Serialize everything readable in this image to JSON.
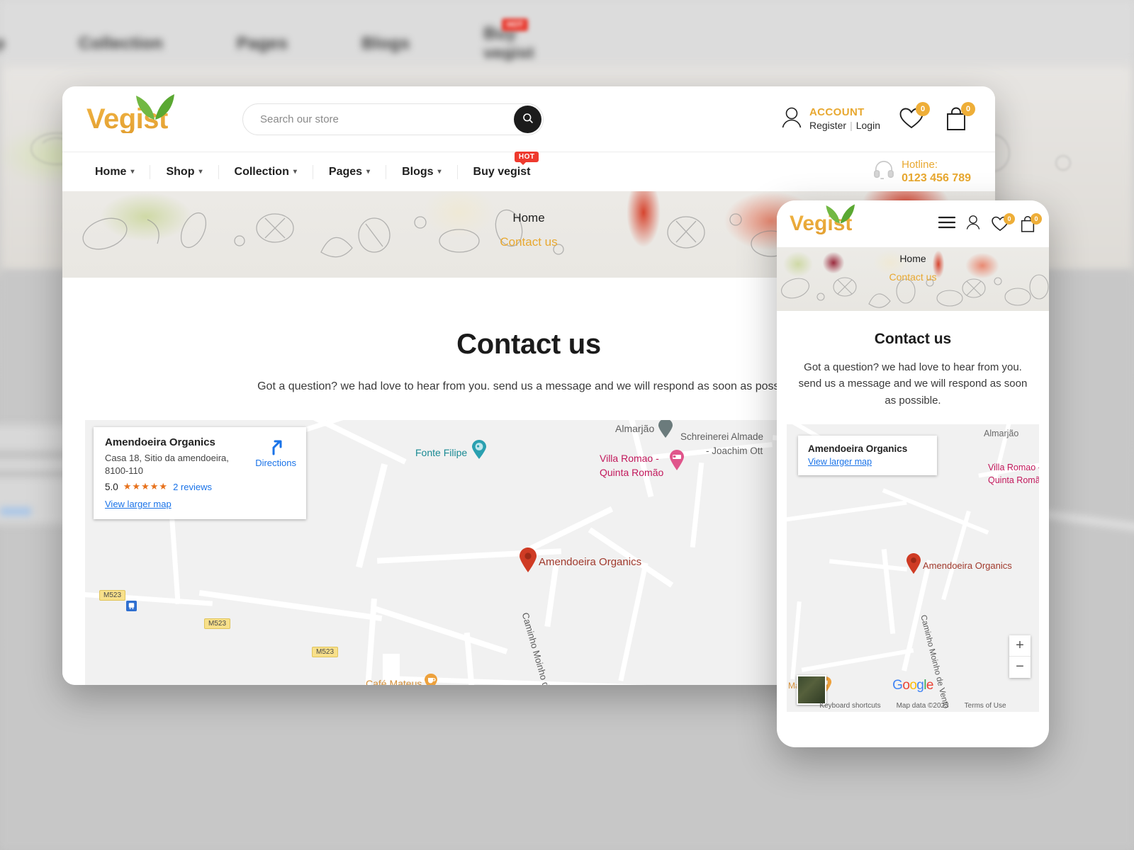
{
  "site": {
    "brand": "Vegist",
    "accent_color": "#e8a830",
    "badge_color": "#eeae38",
    "hot_color": "#ee3a2e"
  },
  "desktop": {
    "search": {
      "placeholder": "Search our store",
      "value": "",
      "icon": "search-icon"
    },
    "account": {
      "title": "ACCOUNT",
      "register": "Register",
      "separator": "|",
      "login": "Login"
    },
    "wishlist_count": "0",
    "cart_count": "0",
    "nav": [
      {
        "label": "Home",
        "has_caret": true,
        "badge": ""
      },
      {
        "label": "Shop",
        "has_caret": true,
        "badge": ""
      },
      {
        "label": "Collection",
        "has_caret": true,
        "badge": ""
      },
      {
        "label": "Pages",
        "has_caret": true,
        "badge": ""
      },
      {
        "label": "Blogs",
        "has_caret": true,
        "badge": ""
      },
      {
        "label": "Buy vegist",
        "has_caret": false,
        "badge": "HOT"
      }
    ],
    "hotline": {
      "label": "Hotline:",
      "number": "0123 456 789"
    },
    "breadcrumb": {
      "home": "Home",
      "current": "Contact us"
    },
    "page": {
      "title": "Contact us",
      "subtitle": "Got a question? we had love to hear from you. send us a message and we will respond as soon as possible."
    }
  },
  "mobile": {
    "wishlist_count": "0",
    "cart_count": "0",
    "breadcrumb": {
      "home": "Home",
      "current": "Contact us"
    },
    "page": {
      "title": "Contact us",
      "subtitle": "Got a question? we had love to hear from you. send us a message and we will respond as soon as possible."
    },
    "map": {
      "info_card": {
        "title": "Amendoeira Organics",
        "view_larger": "View larger map"
      },
      "labels": [
        {
          "text": "Almarjão",
          "color": "#6b6b6b"
        },
        {
          "text": "Villa Romao -",
          "color": "#c2185b"
        },
        {
          "text": "Quinta Romã",
          "color": "#c2185b"
        },
        {
          "text": "Amendoeira Organics",
          "color": "#a0392c"
        },
        {
          "text": "Mateus",
          "color": "#d4903a"
        },
        {
          "text": "Caminho Moinho de Vento",
          "color": "#5a5a5a"
        }
      ],
      "zoom_in": "+",
      "zoom_out": "−",
      "attribution": {
        "keyboard": "Keyboard shortcuts",
        "mapdata": "Map data ©2023",
        "terms": "Terms of Use"
      },
      "google": "Google"
    }
  },
  "desktop_map": {
    "info_card": {
      "title": "Amendoeira Organics",
      "address": "Casa 18, Sitio da amendoeira, 8100-110",
      "rating": "5.0",
      "stars": "★★★★★",
      "reviews": "2 reviews",
      "view_larger": "View larger map",
      "directions": "Directions"
    },
    "labels": [
      {
        "text": "Fonte Filipe",
        "color": "#1a8a94"
      },
      {
        "text": "Almarjão",
        "color": "#5f5f5f"
      },
      {
        "text": "Schreinerei Almade",
        "color": "#5f5f5f"
      },
      {
        "text": "- Joachim Ott",
        "color": "#5f5f5f"
      },
      {
        "text": "Villa Romao -",
        "color": "#c2185b"
      },
      {
        "text": "Quinta Romão",
        "color": "#c2185b"
      },
      {
        "text": "Amendoeira Organics",
        "color": "#a0392c"
      },
      {
        "text": "Café Mateus",
        "color": "#d4903a"
      },
      {
        "text": "Caminho Moinho de Ven",
        "color": "#5a5a5a"
      }
    ],
    "road_chips": [
      "M523",
      "M523",
      "M523"
    ]
  },
  "background": {
    "nav": [
      "p",
      "Collection",
      "Pages",
      "Blogs",
      "Buy vegist"
    ],
    "hot": "HOT"
  }
}
